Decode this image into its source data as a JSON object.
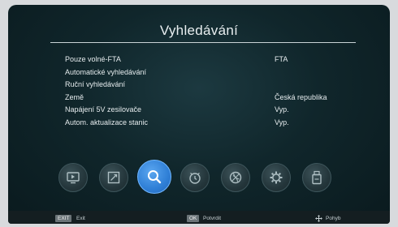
{
  "title": "Vyhledávání",
  "menu": [
    {
      "label": "Pouze volné-FTA",
      "value": "FTA"
    },
    {
      "label": "Automatické vyhledávání",
      "value": ""
    },
    {
      "label": "Ruční vyhledávání",
      "value": ""
    },
    {
      "label": "Země",
      "value": "Česká republika"
    },
    {
      "label": "Napájení 5V zesilovače",
      "value": "Vyp."
    },
    {
      "label": "Autom. aktualizace stanic",
      "value": "Vyp."
    }
  ],
  "icons": [
    "tv-icon",
    "picture-icon",
    "search-icon",
    "clock-icon",
    "globe-icon",
    "gear-icon",
    "usb-icon"
  ],
  "active_icon": "search-icon",
  "bottom_bar": {
    "exit_key": "EXIT",
    "exit_label": "Exit",
    "ok_key": "OK",
    "ok_label": "Potvrdit",
    "move_label": "Pohyb"
  },
  "colors": {
    "accent": "#2f7fd6",
    "background": "#10262b"
  }
}
